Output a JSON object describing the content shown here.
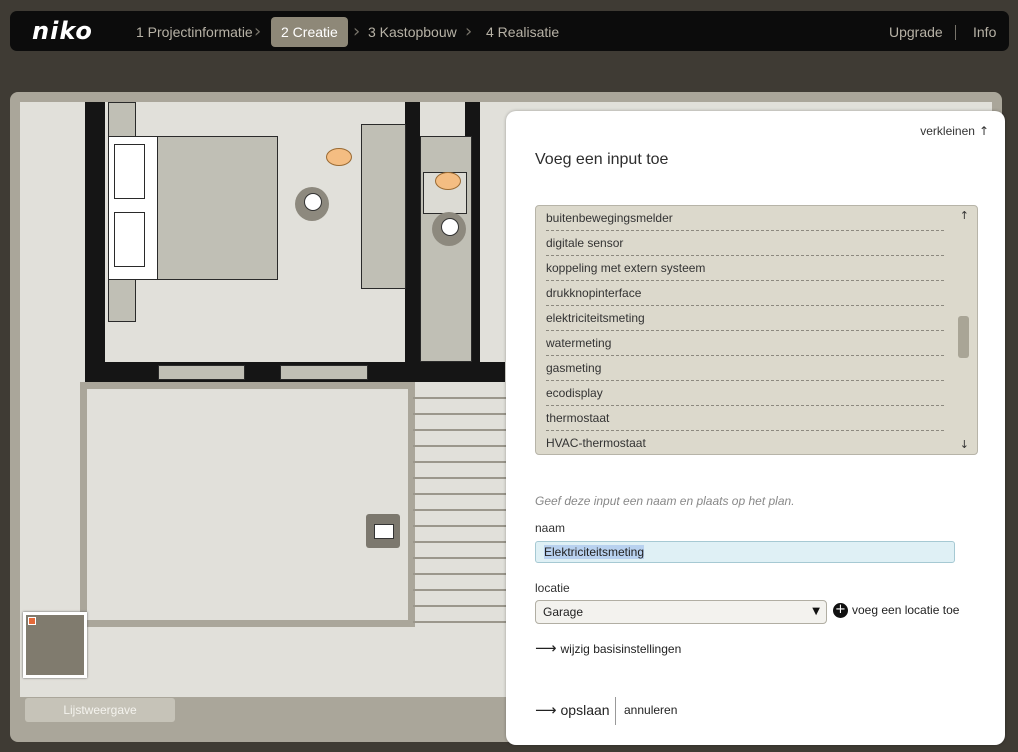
{
  "topbar": {
    "logo": "niko",
    "steps": [
      {
        "label": "1 Projectinformatie",
        "active": false
      },
      {
        "label": "2 Creatie",
        "active": true
      },
      {
        "label": "3 Kastopbouw",
        "active": false
      },
      {
        "label": "4 Realisatie",
        "active": false
      }
    ],
    "links": {
      "upgrade": "Upgrade",
      "info": "Info"
    }
  },
  "canvas": {
    "list_view_button": "Lijstweergave"
  },
  "panel": {
    "collapse_label": "verkleinen",
    "collapse_icon": "arrow-up-icon",
    "title": "Voeg een input toe",
    "input_types": [
      "buitenbewegingsmelder",
      "digitale sensor",
      "koppeling met extern systeem",
      "drukknopinterface",
      "elektriciteitsmeting",
      "watermeting",
      "gasmeting",
      "ecodisplay",
      "thermostaat",
      "HVAC-thermostaat"
    ],
    "hint": "Geef deze input een naam en plaats op het plan.",
    "name_label": "naam",
    "name_value": "Elektriciteitsmeting",
    "location_label": "locatie",
    "location_value": "Garage",
    "add_location": "voeg een locatie toe",
    "basic_settings": "wijzig basisinstellingen",
    "save": "opslaan",
    "cancel": "annuleren"
  }
}
